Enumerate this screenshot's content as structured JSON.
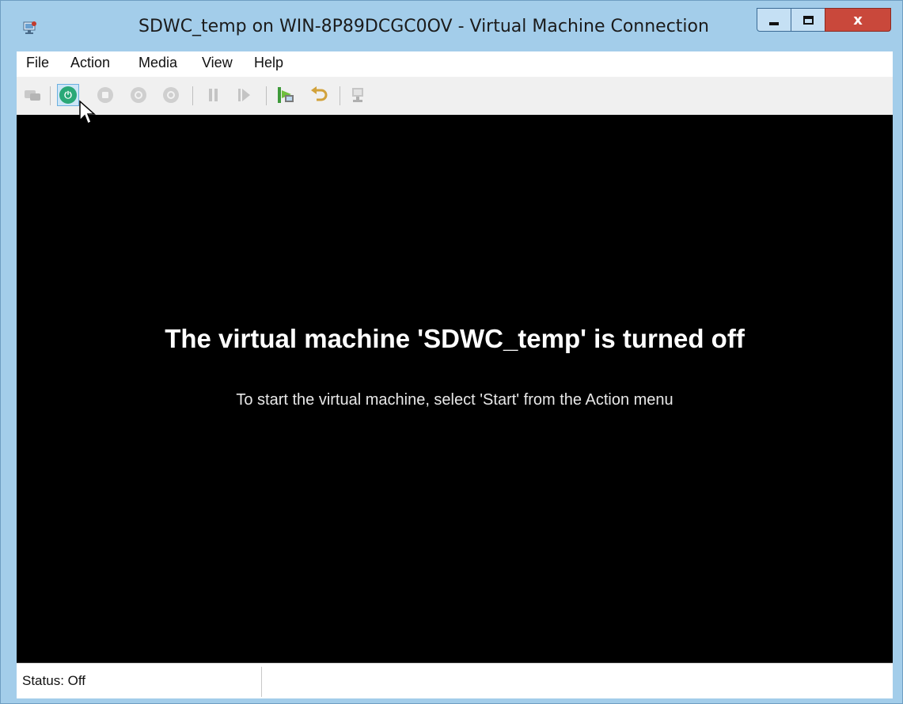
{
  "window": {
    "title": "SDWC_temp on WIN-8P89DCGC0OV - Virtual Machine Connection",
    "icon": "hyper-v-vm-icon",
    "controls": {
      "minimize": "minimize-icon",
      "maximize": "maximize-icon",
      "close": "x"
    }
  },
  "menu": {
    "items": [
      {
        "label": "File"
      },
      {
        "label": "Action"
      },
      {
        "label": "Media"
      },
      {
        "label": "View"
      },
      {
        "label": "Help"
      }
    ]
  },
  "toolbar": {
    "buttons": [
      {
        "icon": "ctrl-alt-del-icon",
        "enabled": false
      },
      {
        "icon": "start-icon",
        "enabled": true,
        "active": true
      },
      {
        "icon": "turn-off-icon",
        "enabled": false
      },
      {
        "icon": "shut-down-icon",
        "enabled": false
      },
      {
        "icon": "save-icon",
        "enabled": false
      },
      {
        "icon": "pause-icon",
        "enabled": false
      },
      {
        "icon": "resume-icon",
        "enabled": false
      },
      {
        "icon": "checkpoint-icon",
        "enabled": true
      },
      {
        "icon": "revert-icon",
        "enabled": true
      },
      {
        "icon": "enhanced-session-icon",
        "enabled": false
      }
    ]
  },
  "screen": {
    "heading": "The virtual machine 'SDWC_temp' is turned off",
    "instruction": "To start the virtual machine, select 'Start' from the Action menu",
    "background": "#000000"
  },
  "status": {
    "text": "Status: Off"
  },
  "colors": {
    "frame": "#a3cdea",
    "close_button": "#c9483b",
    "start_button": "#2aa877"
  }
}
